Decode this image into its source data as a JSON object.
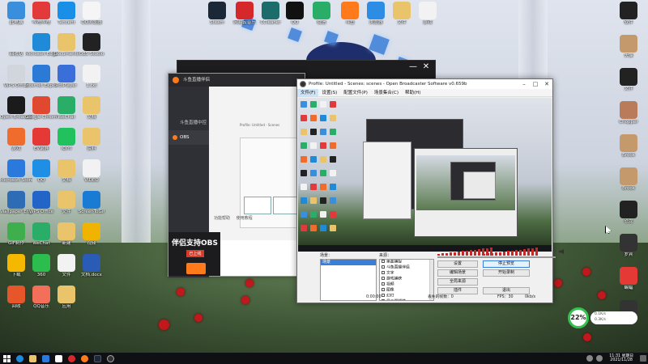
{
  "desktop_left_icons": [
    {
      "label": "此电脑",
      "color": "#3a8fdd"
    },
    {
      "label": "哔哩哔哩",
      "color": "#e23a3a",
      "glyph": "哔"
    },
    {
      "label": "Tencent",
      "color": "#1a8fe8"
    },
    {
      "label": "QQ浏览器",
      "color": "#f5f5f5"
    },
    {
      "label": "回收站",
      "color": "#dbe2ec"
    },
    {
      "label": "Microsoft Edge",
      "color": "#1f8ad8"
    },
    {
      "label": "Documents",
      "color": "#e9c46a"
    },
    {
      "label": "OBS Studio",
      "color": "#222222"
    },
    {
      "label": "WPS Office",
      "color": "#d1d5dc"
    },
    {
      "label": "Internet Explorer",
      "color": "#2b7bd6"
    },
    {
      "label": "PotPlayer",
      "color": "#3a6ed8"
    },
    {
      "label": "1.txt",
      "color": "#f2f2f2"
    },
    {
      "label": "Open Broadcaster",
      "color": "#1b1b1b"
    },
    {
      "label": "Google Chrome",
      "color": "#e0492f"
    },
    {
      "label": "WeChat",
      "color": "#2aae67"
    },
    {
      "label": "文档",
      "color": "#e9c46a"
    },
    {
      "label": "游戏",
      "color": "#f06c2c"
    },
    {
      "label": "EV录屏",
      "color": "#e53935"
    },
    {
      "label": "iQIYI",
      "color": "#21c25e"
    },
    {
      "label": "资料",
      "color": "#e9c46a"
    },
    {
      "label": "Microsoft Store",
      "color": "#2a7ade"
    },
    {
      "label": "QQ",
      "color": "#1f8fe5"
    },
    {
      "label": "文档",
      "color": "#e9c46a"
    },
    {
      "label": "VIDEO",
      "color": "#f2f2f2"
    },
    {
      "label": "Wallpaper Engine",
      "color": "#2e6db5"
    },
    {
      "label": "WPS Office",
      "color": "#2264c8"
    },
    {
      "label": "文件",
      "color": "#e9c46a"
    },
    {
      "label": "ScreenToGif",
      "color": "#1a7bd4"
    },
    {
      "label": "GIF制作",
      "color": "#3fae4d"
    },
    {
      "label": "WeChat",
      "color": "#2aae67"
    },
    {
      "label": "新建",
      "color": "#e9c46a"
    },
    {
      "label": "视频",
      "color": "#f0b400"
    },
    {
      "label": "下载",
      "color": "#f5b800"
    },
    {
      "label": "360",
      "color": "#2bbd4d"
    },
    {
      "label": "文件",
      "color": "#f2f2f2"
    },
    {
      "label": "文档.docx",
      "color": "#2a5bb5"
    },
    {
      "label": "回收",
      "color": "#e7552b"
    },
    {
      "label": "QQ音乐",
      "color": "#f36f5a"
    },
    {
      "label": "应用",
      "color": "#e9c46a"
    }
  ],
  "desktop_top_icons": [
    {
      "label": "Steam",
      "color": "#1b2838"
    },
    {
      "label": "网易云音乐",
      "color": "#d4282b"
    },
    {
      "label": "CCleaner",
      "color": "#1c6c6c"
    },
    {
      "label": "QQ",
      "color": "#111111"
    },
    {
      "label": "微信",
      "color": "#2aae67"
    },
    {
      "label": "斗鱼",
      "color": "#ff7a1a"
    },
    {
      "label": "浏览器",
      "color": "#2d8ce3"
    },
    {
      "label": "文件",
      "color": "#e9c46a"
    },
    {
      "label": "游戏",
      "color": "#f2f2f2"
    }
  ],
  "desktop_right_icons": [
    {
      "label": "软件",
      "color": "#222222"
    },
    {
      "label": "头像",
      "color": "#c49a6c"
    },
    {
      "label": "文件",
      "color": "#222222"
    },
    {
      "label": "Chopper",
      "color": "#b97b5a"
    },
    {
      "label": "Brook",
      "color": "#c49a6c"
    },
    {
      "label": "Brook",
      "color": "#c49a6c"
    },
    {
      "label": "恐龙",
      "color": "#222222"
    },
    {
      "label": "罗宾",
      "color": "#333333"
    },
    {
      "label": "蝙蝠",
      "color": "#e53935"
    },
    {
      "label": "回收站",
      "color": "#333333"
    }
  ],
  "dark_window": {
    "close": "✕",
    "min": "—"
  },
  "douyu": {
    "title": "斗鱼直播伴侣",
    "sidebar": [
      "斗鱼直播中控",
      "OBS"
    ],
    "preview_bar": "Profile: Untitled - Scenes",
    "bottom_links": [
      "功能帮助",
      "使用教程"
    ],
    "ad_title": "伴侣支持OBS",
    "ad_sub": "已上线"
  },
  "obs": {
    "title": "Profile: Untitled - Scenes: scenes - Open Broadcaster Software v0.659b",
    "menu": [
      "文件(F)",
      "设置(S)",
      "配置文件(P)",
      "场景集合(C)",
      "帮助(H)"
    ],
    "scenes_label": "场景：",
    "scene_selected": "场景",
    "sources_label": "来源：",
    "sources": [
      "桌面捕捉",
      "斗鱼直播伴侣",
      "文字",
      "游戏捕获",
      "视频",
      "图像",
      "幻灯",
      "显示器捕获"
    ],
    "buttons": {
      "settings": "设置",
      "stop_preview": "停止预览",
      "edit_scene": "编辑场景",
      "start_record": "开始录制",
      "global_sources": "全局来源",
      "plugins": "插件",
      "exit": "退出"
    },
    "status": {
      "time": "0:00:00",
      "dropped": "丢失的帧数：0",
      "fps": "FPS：30",
      "kbps": "0kb/s"
    }
  },
  "net_widget": {
    "percent": "22%",
    "up": "0.1K/s",
    "down": "0.3K/s"
  },
  "taskbar": {
    "time": "11:31",
    "day": "星期日",
    "date": "2021/11/28"
  }
}
